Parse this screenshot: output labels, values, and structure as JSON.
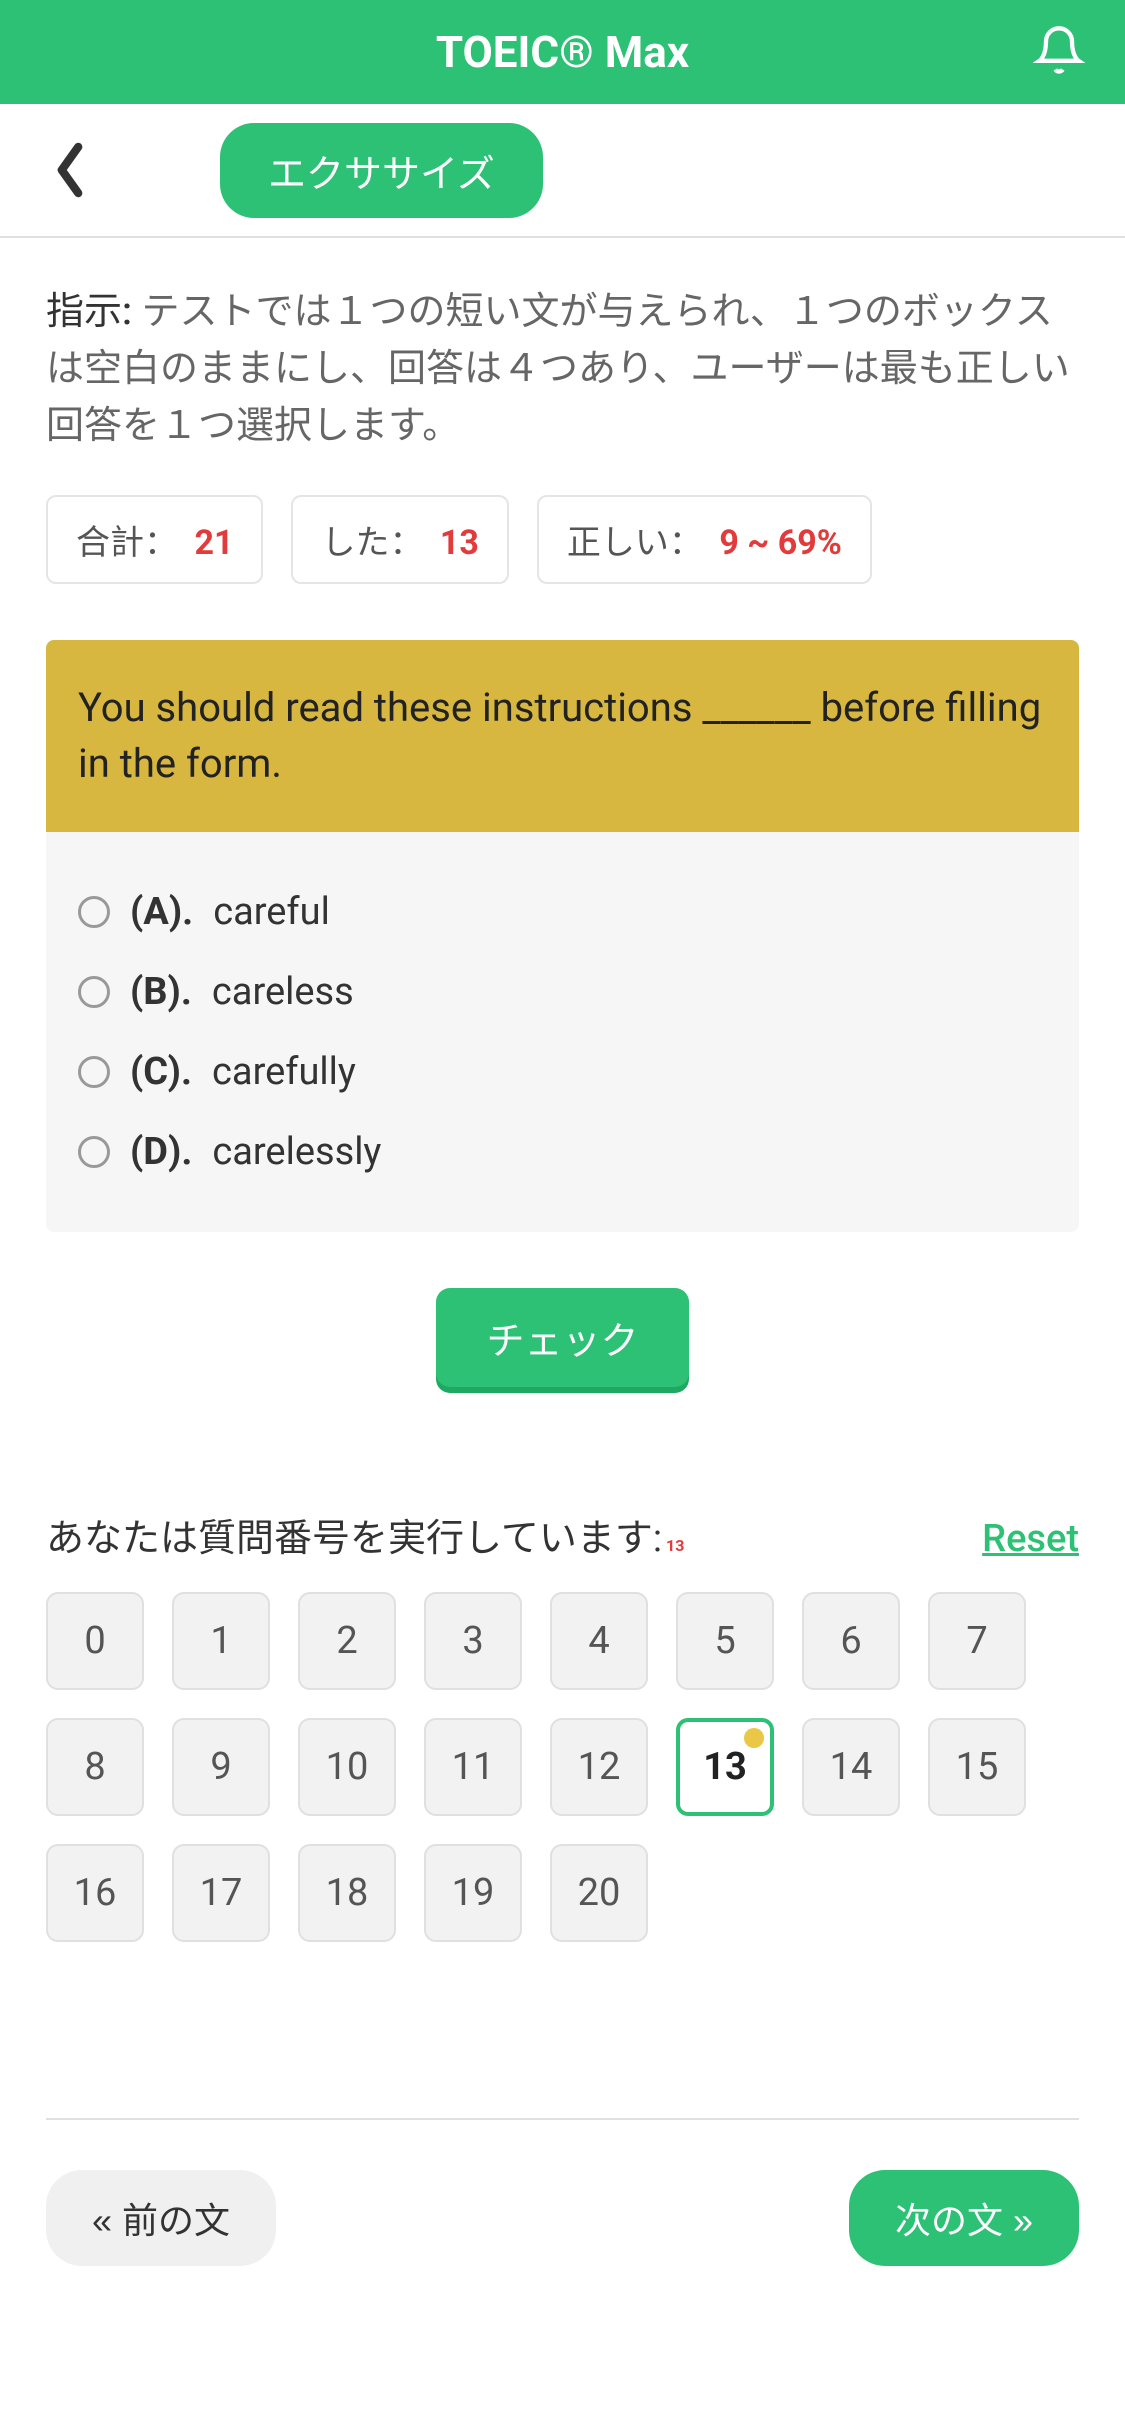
{
  "header": {
    "title": "TOEIC® Max"
  },
  "nav": {
    "exercise_label": "エクササイズ"
  },
  "instructions": {
    "label": "指示:",
    "text": "テストでは１つの短い文が与えられ、１つのボックスは空白のままにし、回答は４つあり、ユーザーは最も正しい回答を１つ選択します。"
  },
  "stats": {
    "total_label": "合計：",
    "total_value": "21",
    "done_label": "した：",
    "done_value": "13",
    "correct_label": "正しい：",
    "correct_value": "9 ~ 69%"
  },
  "question": {
    "text": "You should read these instructions ______ before filling in the form.",
    "options": [
      {
        "letter": "(A).",
        "text": "careful"
      },
      {
        "letter": "(B).",
        "text": "careless"
      },
      {
        "letter": "(C).",
        "text": "carefully"
      },
      {
        "letter": "(D).",
        "text": "carelessly"
      }
    ]
  },
  "check_button": "チェック",
  "question_nav": {
    "label": "あなたは質問番号を実行しています:",
    "current": "13",
    "reset": "Reset",
    "numbers": [
      "0",
      "1",
      "2",
      "3",
      "4",
      "5",
      "6",
      "7",
      "8",
      "9",
      "10",
      "11",
      "12",
      "13",
      "14",
      "15",
      "16",
      "17",
      "18",
      "19",
      "20"
    ]
  },
  "bottom_nav": {
    "prev": "« 前の文",
    "next": "次の文 »"
  }
}
